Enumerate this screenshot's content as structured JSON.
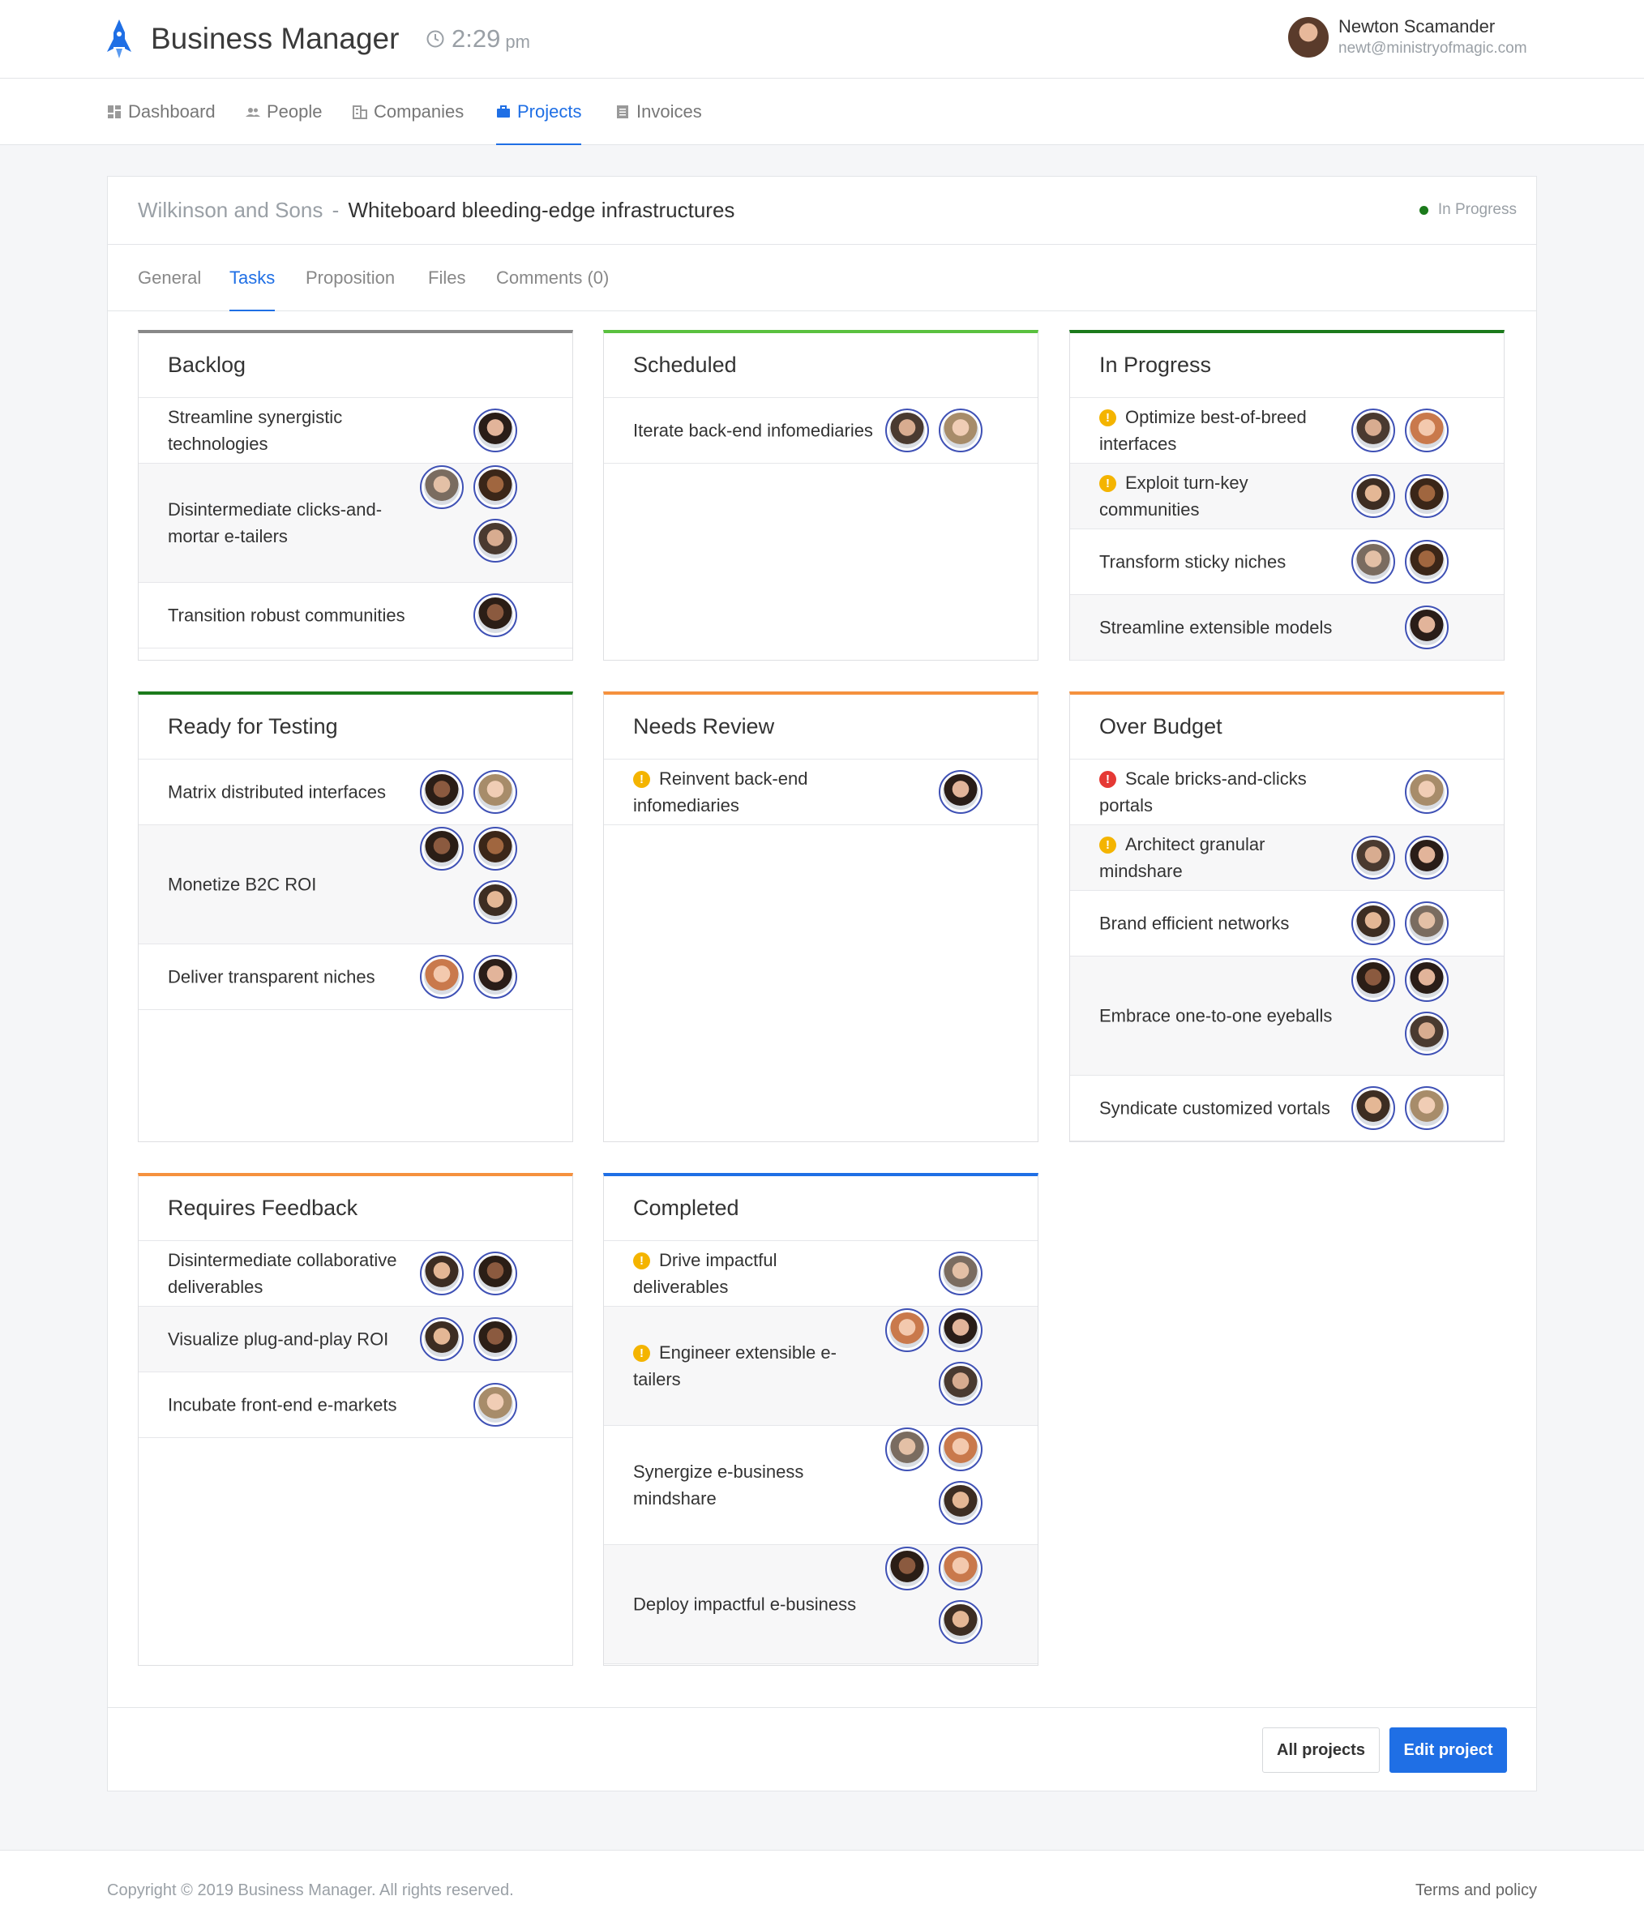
{
  "app": {
    "name": "Business Manager",
    "time": "2:29",
    "ampm": "pm",
    "user_name": "Newton Scamander",
    "user_email": "newt@ministryofmagic.com",
    "accent_color": "#1f6fe5"
  },
  "nav": [
    {
      "label": "Dashboard",
      "icon": "dashboard-icon",
      "active": false
    },
    {
      "label": "People",
      "icon": "people-icon",
      "active": false
    },
    {
      "label": "Companies",
      "icon": "companies-icon",
      "active": false
    },
    {
      "label": "Projects",
      "icon": "briefcase-icon",
      "active": true
    },
    {
      "label": "Invoices",
      "icon": "invoice-icon",
      "active": false
    }
  ],
  "project": {
    "company": "Wilkinson and Sons",
    "separator": "-",
    "name": "Whiteboard bleeding-edge infrastructures",
    "status": "In Progress",
    "status_color": "#1b7a1b"
  },
  "tabs": [
    "General",
    "Tasks",
    "Proposition",
    "Files",
    "Comments (0)"
  ],
  "active_tab": "Tasks",
  "columns": [
    {
      "title": "Backlog",
      "color": "#888888",
      "tasks": [
        {
          "text": "Streamline synergistic technologies",
          "flag": null,
          "avatars": [
            "f1"
          ]
        },
        {
          "text": "Disintermediate clicks-and-mortar e-tailers",
          "flag": null,
          "avatars": [
            "m5",
            "m3",
            "m2"
          ]
        },
        {
          "text": "Transition robust communities",
          "flag": null,
          "avatars": [
            "m1"
          ]
        }
      ]
    },
    {
      "title": "Scheduled",
      "color": "#5ac13f",
      "tasks": [
        {
          "text": "Iterate back-end infomediaries",
          "flag": null,
          "avatars": [
            "m2",
            "f2"
          ]
        }
      ]
    },
    {
      "title": "In Progress",
      "color": "#1b7a1b",
      "tasks": [
        {
          "text": "Optimize best-of-breed interfaces",
          "flag": "warning",
          "avatars": [
            "m2",
            "f3"
          ]
        },
        {
          "text": "Exploit turn-key communities",
          "flag": "warning",
          "avatars": [
            "m4",
            "m3"
          ]
        },
        {
          "text": "Transform sticky niches",
          "flag": null,
          "avatars": [
            "m5",
            "m3"
          ]
        },
        {
          "text": "Streamline extensible models",
          "flag": null,
          "avatars": [
            "f1"
          ]
        }
      ]
    },
    {
      "title": "Ready for Testing",
      "color": "#1b7a1b",
      "tasks": [
        {
          "text": "Matrix distributed interfaces",
          "flag": null,
          "avatars": [
            "m1",
            "f2"
          ]
        },
        {
          "text": "Monetize B2C ROI",
          "flag": null,
          "avatars": [
            "m1",
            "m3",
            "m4"
          ]
        },
        {
          "text": "Deliver transparent niches",
          "flag": null,
          "avatars": [
            "f3",
            "f1"
          ]
        }
      ]
    },
    {
      "title": "Needs Review",
      "color": "#f5913e",
      "tasks": [
        {
          "text": "Reinvent back-end infomediaries",
          "flag": "warning",
          "avatars": [
            "f1"
          ]
        }
      ]
    },
    {
      "title": "Over Budget",
      "color": "#f5913e",
      "tasks": [
        {
          "text": "Scale bricks-and-clicks portals",
          "flag": "error",
          "avatars": [
            "f2"
          ]
        },
        {
          "text": "Architect granular mindshare",
          "flag": "warning",
          "avatars": [
            "m2",
            "f1"
          ]
        },
        {
          "text": "Brand efficient networks",
          "flag": null,
          "avatars": [
            "m4",
            "m5"
          ]
        },
        {
          "text": "Embrace one-to-one eyeballs",
          "flag": null,
          "avatars": [
            "m1",
            "f1",
            "m2"
          ]
        },
        {
          "text": "Syndicate customized vortals",
          "flag": null,
          "avatars": [
            "m4",
            "f2"
          ]
        }
      ]
    },
    {
      "title": "Requires Feedback",
      "color": "#f5913e",
      "tasks": [
        {
          "text": "Disintermediate collaborative deliverables",
          "flag": null,
          "avatars": [
            "m4",
            "m1"
          ]
        },
        {
          "text": "Visualize plug-and-play ROI",
          "flag": null,
          "avatars": [
            "m4",
            "m1"
          ]
        },
        {
          "text": "Incubate front-end e-markets",
          "flag": null,
          "avatars": [
            "f2"
          ]
        }
      ]
    },
    {
      "title": "Completed",
      "color": "#1f6fe5",
      "tasks": [
        {
          "text": "Drive impactful deliverables",
          "flag": "warning",
          "avatars": [
            "m5"
          ]
        },
        {
          "text": "Engineer extensible e-tailers",
          "flag": "warning",
          "avatars": [
            "f3",
            "f1",
            "m2"
          ]
        },
        {
          "text": "Synergize e-business mindshare",
          "flag": null,
          "avatars": [
            "m5",
            "f3",
            "m4"
          ]
        },
        {
          "text": "Deploy impactful e-business",
          "flag": null,
          "avatars": [
            "m1",
            "f3",
            "m4"
          ]
        }
      ]
    }
  ],
  "buttons": {
    "all_projects": "All projects",
    "edit_project": "Edit project"
  },
  "footer": {
    "copyright": "Copyright © 2019 Business Manager. All rights reserved.",
    "terms": "Terms and policy"
  }
}
